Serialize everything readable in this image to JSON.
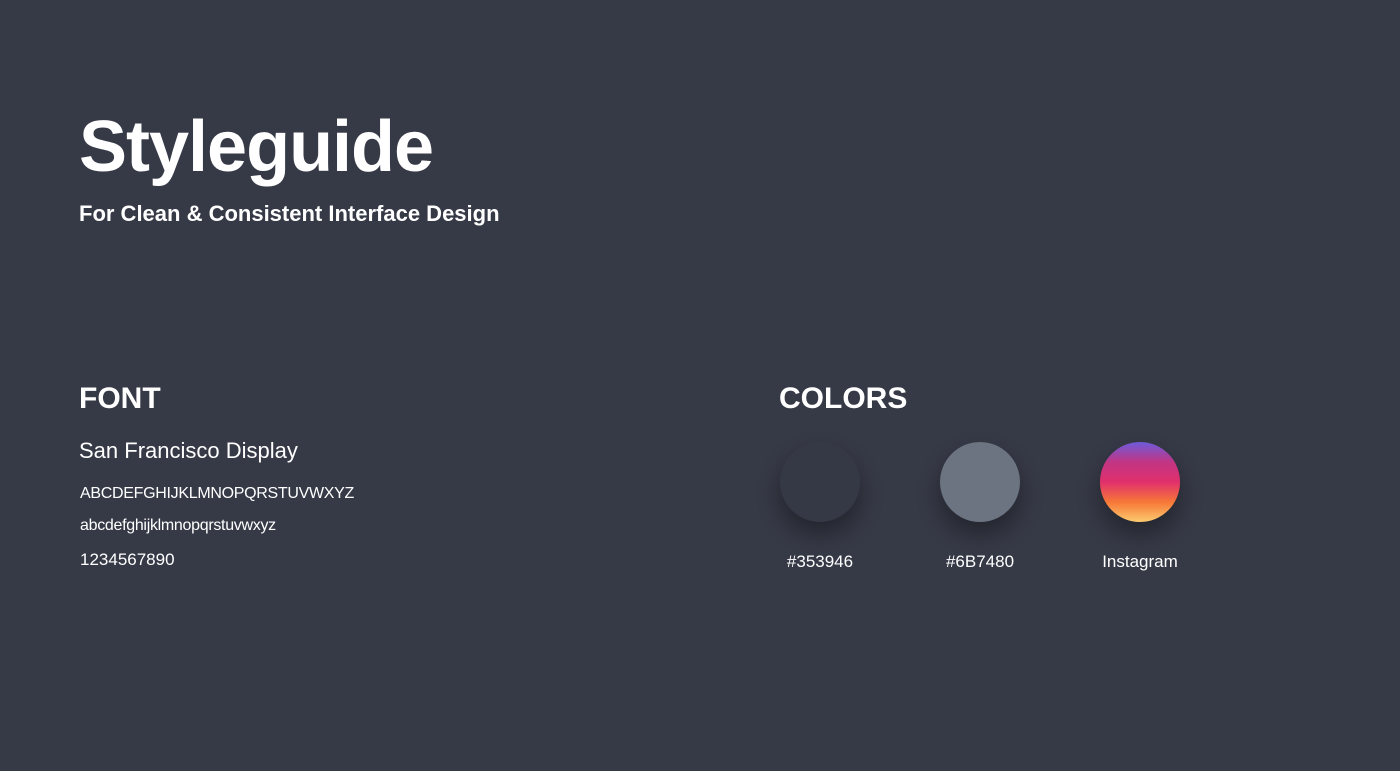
{
  "header": {
    "title": "Styleguide",
    "subtitle": "For Clean & Consistent Interface Design"
  },
  "font_section": {
    "heading": "FONT",
    "font_name": "San Francisco Display",
    "uppercase_sample": "ABCDEFGHIJKLMNOPQRSTUVWXYZ",
    "lowercase_sample": "abcdefghijklmnopqrstuvwxyz",
    "digits_sample": "1234567890"
  },
  "colors_section": {
    "heading": "COLORS",
    "swatches": [
      {
        "label": "#353946",
        "color": "#353946"
      },
      {
        "label": "#6B7480",
        "color": "#6B7480"
      },
      {
        "label": "Instagram",
        "gradient": [
          "#6E5BDB",
          "#C13584",
          "#E1306C",
          "#F77737",
          "#FCCB6F"
        ]
      }
    ]
  },
  "colors": {
    "background": "#363946",
    "text": "#FFFFFF"
  }
}
